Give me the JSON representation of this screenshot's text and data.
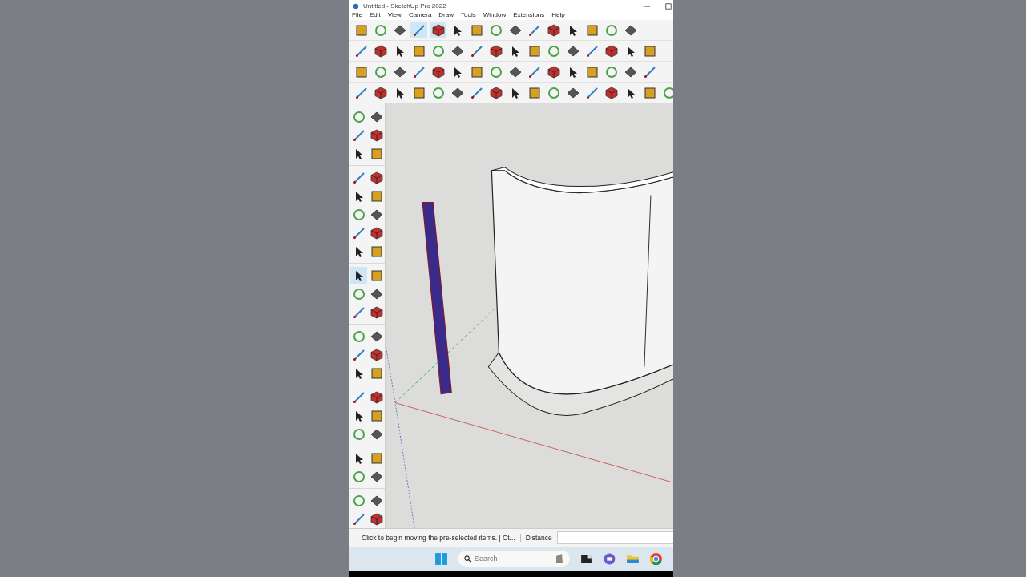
{
  "window": {
    "title": "Untitled - SketchUp Pro 2022",
    "minimize": "—"
  },
  "menu": [
    "File",
    "Edit",
    "View",
    "Camera",
    "Draw",
    "Tools",
    "Window",
    "Extensions",
    "Help"
  ],
  "top_toolbar_rows": [
    [
      false,
      false,
      false,
      true,
      true,
      false,
      false,
      false,
      false,
      false,
      false,
      false,
      false,
      false,
      false
    ],
    [
      false,
      false,
      false,
      false,
      false,
      false,
      false,
      false,
      false,
      false,
      false,
      false,
      false,
      false,
      false,
      false
    ],
    [
      false,
      false,
      false,
      false,
      false,
      false,
      false,
      false,
      false,
      false,
      false,
      false,
      false,
      false,
      false,
      false
    ],
    [
      false,
      false,
      false,
      false,
      false,
      false,
      false,
      false,
      false,
      false,
      false,
      false,
      false,
      false,
      false,
      false,
      false
    ]
  ],
  "left_toolbar_groups": [
    [
      false,
      false,
      false,
      false,
      false,
      false
    ],
    [
      false,
      false,
      false,
      false,
      false,
      false,
      false,
      false,
      false,
      false
    ],
    [
      true,
      false,
      false,
      false,
      false,
      false
    ],
    [
      false,
      false,
      false,
      false,
      false,
      false
    ],
    [
      false,
      false,
      false,
      false,
      false,
      false
    ],
    [
      false,
      false,
      false,
      false
    ],
    [
      false,
      false,
      false,
      false
    ]
  ],
  "status_bar": {
    "message": "Click to begin moving the pre-selected items. | Ct...",
    "measure_label": "Distance"
  },
  "taskbar": {
    "search_placeholder": "Search"
  }
}
